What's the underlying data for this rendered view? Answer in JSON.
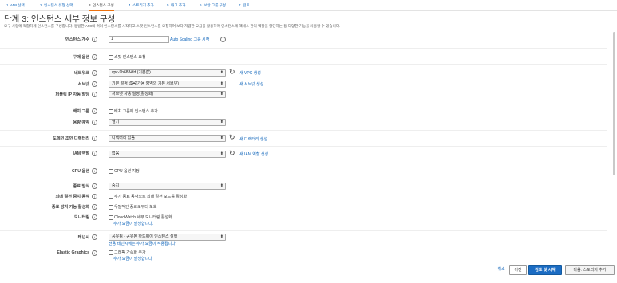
{
  "steps": [
    "1. AMI 선택",
    "2. 인스턴스 유형 선택",
    "3. 인스턴스 구성",
    "4. 스토리지 추가",
    "5. 태그 추가",
    "6. 보안 그룹 구성",
    "7. 검토"
  ],
  "active_step": 2,
  "page_title": "단계 3: 인스턴스 세부 정보 구성",
  "description": "요구 사항에 적합하게 인스턴스를 구성합니다. 동일한 AMI의 여러 인스턴스를 시작하고 스팟 인스턴스를 요청하여 보다 저렴한 요금을 활용하며 인스턴스에 액세스 관리 역할을 할당하는 등 다양한 기능을 사용할 수 있습니다.",
  "form": {
    "instance_count": {
      "label": "인스턴스 개수",
      "value": "1",
      "link": "Auto Scaling 그룹 시작"
    },
    "purchase_option": {
      "label": "구매 옵션",
      "checkbox": "스팟 인스턴스 요청"
    },
    "network": {
      "label": "네트워크",
      "value": "vpc-9b6884fd (기본값)",
      "link": "새 VPC 생성"
    },
    "subnet": {
      "label": "서브넷",
      "value": "기본 설정 없음(가용 영역의 기본 서브넷)",
      "link": "새 서브넷 생성"
    },
    "public_ip": {
      "label": "퍼블릭 IP 자동 할당",
      "value": "서브넷 사용 설정(활성화)"
    },
    "placement_group": {
      "label": "배치 그룹",
      "checkbox": "배치 그룹에 인스턴스 추가"
    },
    "capacity_reservation": {
      "label": "용량 예약",
      "value": "열기"
    },
    "domain_directory": {
      "label": "도메인 조인 디렉터리",
      "value": "디렉터리 없음",
      "link": "새 디렉터리 생성"
    },
    "iam_role": {
      "label": "IAM 역할",
      "value": "없음",
      "link": "새 IAM 역할 생성"
    },
    "cpu_options": {
      "label": "CPU 옵션",
      "checkbox": "CPU 옵션 지정"
    },
    "shutdown_behavior": {
      "label": "종료 방식",
      "value": "중지"
    },
    "stop_hibernate": {
      "label": "최대 절전 중지 동작",
      "checkbox": "추가 종료 동작으로 최대 절전 모드를 활성화"
    },
    "termination_protection": {
      "label": "종료 방지 기능 활성화",
      "checkbox": "우발적인 종료로부터 보호"
    },
    "monitoring": {
      "label": "모니터링",
      "checkbox": "CloudWatch 세부 모니터링 활성화",
      "note": "추가 요금이 발생합니다."
    },
    "tenancy": {
      "label": "테넌시",
      "value": "공유됨 - 공유된 하드웨어 인스턴스 실행",
      "note": "전용 테넌시에는 추가 요금이 적용됩니다."
    },
    "elastic_graphics": {
      "label": "Elastic Graphics",
      "checkbox": "그래픽 가속화 추가",
      "note": "추가 요금이 발생합니다"
    }
  },
  "info_icon": "i",
  "caret_icon": "⬍",
  "refresh_icon": "↻",
  "buttons": {
    "cancel": "취소",
    "previous": "이전",
    "review_launch": "검토 및 시작",
    "next": "다음: 스토리지 추가"
  },
  "colors": {
    "link": "#1166bb",
    "primary": "#1b6cc3",
    "active_tab": "#ec7211"
  }
}
